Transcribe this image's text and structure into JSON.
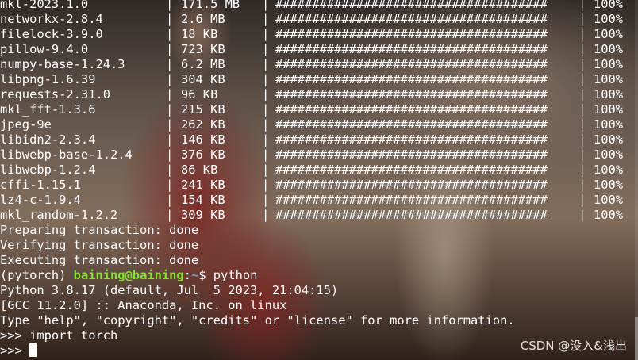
{
  "packages": [
    {
      "name": "mkl-2023.1.0",
      "size": "171.5 MB",
      "bar": "##################################### ",
      "percent": "100%"
    },
    {
      "name": "networkx-2.8.4",
      "size": "2.6 MB",
      "bar": "##################################### ",
      "percent": "100%"
    },
    {
      "name": "filelock-3.9.0",
      "size": "18 KB",
      "bar": "##################################### ",
      "percent": "100%"
    },
    {
      "name": "pillow-9.4.0",
      "size": "723 KB",
      "bar": "##################################### ",
      "percent": "100%"
    },
    {
      "name": "numpy-base-1.24.3",
      "size": "6.2 MB",
      "bar": "##################################### ",
      "percent": "100%"
    },
    {
      "name": "libpng-1.6.39",
      "size": "304 KB",
      "bar": "##################################### ",
      "percent": "100%"
    },
    {
      "name": "requests-2.31.0",
      "size": "96 KB",
      "bar": "##################################### ",
      "percent": "100%"
    },
    {
      "name": "mkl_fft-1.3.6",
      "size": "215 KB",
      "bar": "##################################### ",
      "percent": "100%"
    },
    {
      "name": "jpeg-9e",
      "size": "262 KB",
      "bar": "##################################### ",
      "percent": "100%"
    },
    {
      "name": "libidn2-2.3.4",
      "size": "146 KB",
      "bar": "##################################### ",
      "percent": "100%"
    },
    {
      "name": "libwebp-base-1.2.4",
      "size": "376 KB",
      "bar": "##################################### ",
      "percent": "100%"
    },
    {
      "name": "libwebp-1.2.4",
      "size": "86 KB",
      "bar": "##################################### ",
      "percent": "100%"
    },
    {
      "name": "cffi-1.15.1",
      "size": "241 KB",
      "bar": "##################################### ",
      "percent": "100%"
    },
    {
      "name": "lz4-c-1.9.4",
      "size": "154 KB",
      "bar": "##################################### ",
      "percent": "100%"
    },
    {
      "name": "mkl_random-1.2.2",
      "size": "309 KB",
      "bar": "##################################### ",
      "percent": "100%"
    }
  ],
  "separator": "|",
  "status_lines": [
    "Preparing transaction: done",
    "Verifying transaction: done",
    "Executing transaction: done"
  ],
  "prompt": {
    "env": "(pytorch) ",
    "user_host": "baining@baining",
    "colon": ":",
    "path": "~",
    "symbol": "$ ",
    "command": "python"
  },
  "python_banner": [
    "Python 3.8.17 (default, Jul  5 2023, 21:04:15)",
    "[GCC 11.2.0] :: Anaconda, Inc. on linux",
    "Type \"help\", \"copyright\", \"credits\" or \"license\" for more information."
  ],
  "repl": {
    "input_line": ">>> import torch",
    "current_prompt": ">>> "
  },
  "watermark": "CSDN @没入&浅出",
  "colors": {
    "user_host": "#8ae234",
    "path": "#729fcf",
    "text": "#ffffff"
  }
}
